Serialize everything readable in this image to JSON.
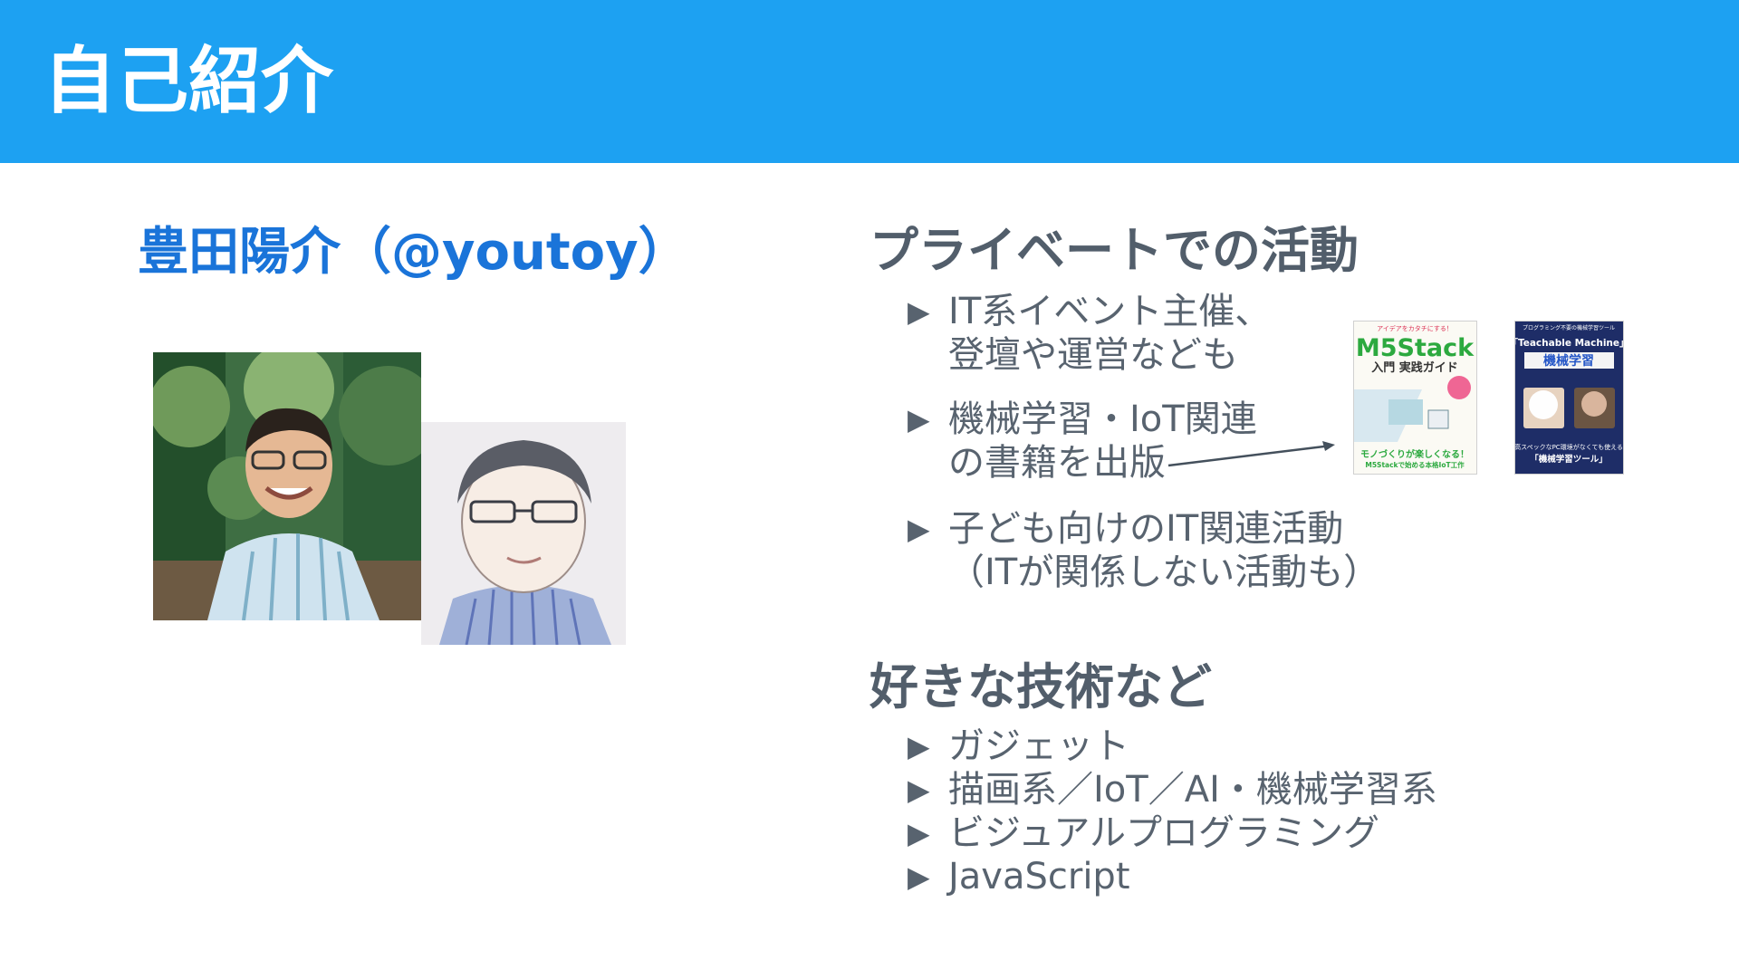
{
  "header": {
    "title": "自己紹介"
  },
  "profile": {
    "name": "豊田陽介（@youtoy）"
  },
  "activities": {
    "title": "プライベートでの活動",
    "items": [
      {
        "line1": "IT系イベント主催、",
        "line2": "登壇や運営なども"
      },
      {
        "line1": "機械学習・IoT関連",
        "line2": "の書籍を出版"
      },
      {
        "line1": "子ども向けのIT関連活動",
        "line2": "（ITが関係しない活動も）"
      }
    ]
  },
  "books": [
    {
      "top": "アイデアをカタチにする！",
      "brand": "M5Stack",
      "subtitle": "入門 実践ガイド",
      "bottom1": "モノづくりが楽しくなる！",
      "bottom2": "M5Stackで始める本格IoT工作"
    },
    {
      "top": "プログラミング不要の機械学習ツール",
      "brand": "「Teachable Machine」",
      "subtitle": "機械学習",
      "bottom1": "高スペックなPC環境がなくても使える",
      "bottom2": "「機械学習ツール」"
    }
  ],
  "tech": {
    "title": "好きな技術など",
    "items": [
      "ガジェット",
      "描画系／IoT／AI・機械学習系",
      "ビジュアルプログラミング",
      "JavaScript"
    ]
  },
  "icons": {
    "bullet_marker": "▶"
  },
  "colors": {
    "header_bg": "#1da1f2",
    "name": "#1a74d9",
    "text": "#58636f"
  }
}
